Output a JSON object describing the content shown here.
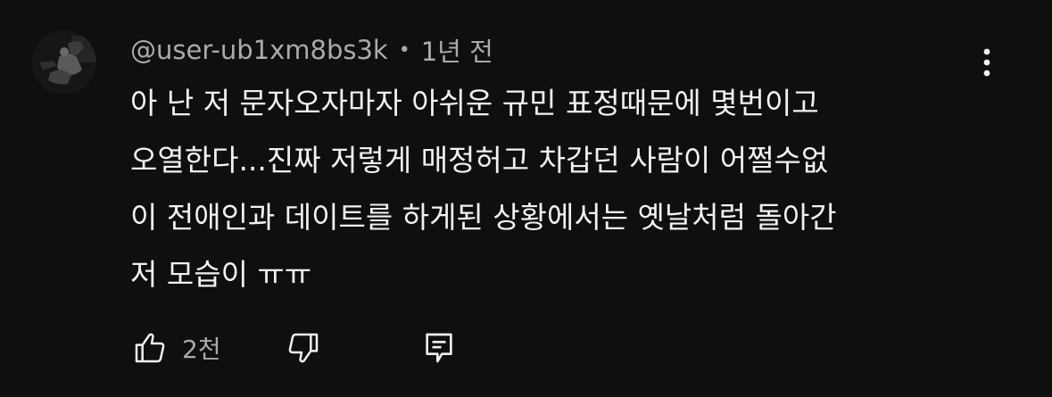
{
  "comment": {
    "author": "@user-ub1xm8bs3k",
    "separator": "•",
    "timestamp": "1년 전",
    "text_lines": [
      "아 난 저 문자오자마자 아쉬운 규민 표정때문에 몇번이고",
      "오열한다...진짜 저렇게 매정허고 차갑던 사람이 어쩔수없",
      "이 전애인과 데이트를 하게된 상황에서는 옛날처럼 돌아간",
      "저 모습이 ㅠㅠ"
    ],
    "like_count": "2천"
  },
  "icons": {
    "avatar": "avatar-image",
    "more": "more-vertical-icon",
    "like": "thumb-up-icon",
    "dislike": "thumb-down-icon",
    "reply": "comment-reply-icon"
  },
  "colors": {
    "background": "#0f0f0f",
    "primary_text": "#f1f1f1",
    "secondary_text": "#aaaaaa"
  }
}
